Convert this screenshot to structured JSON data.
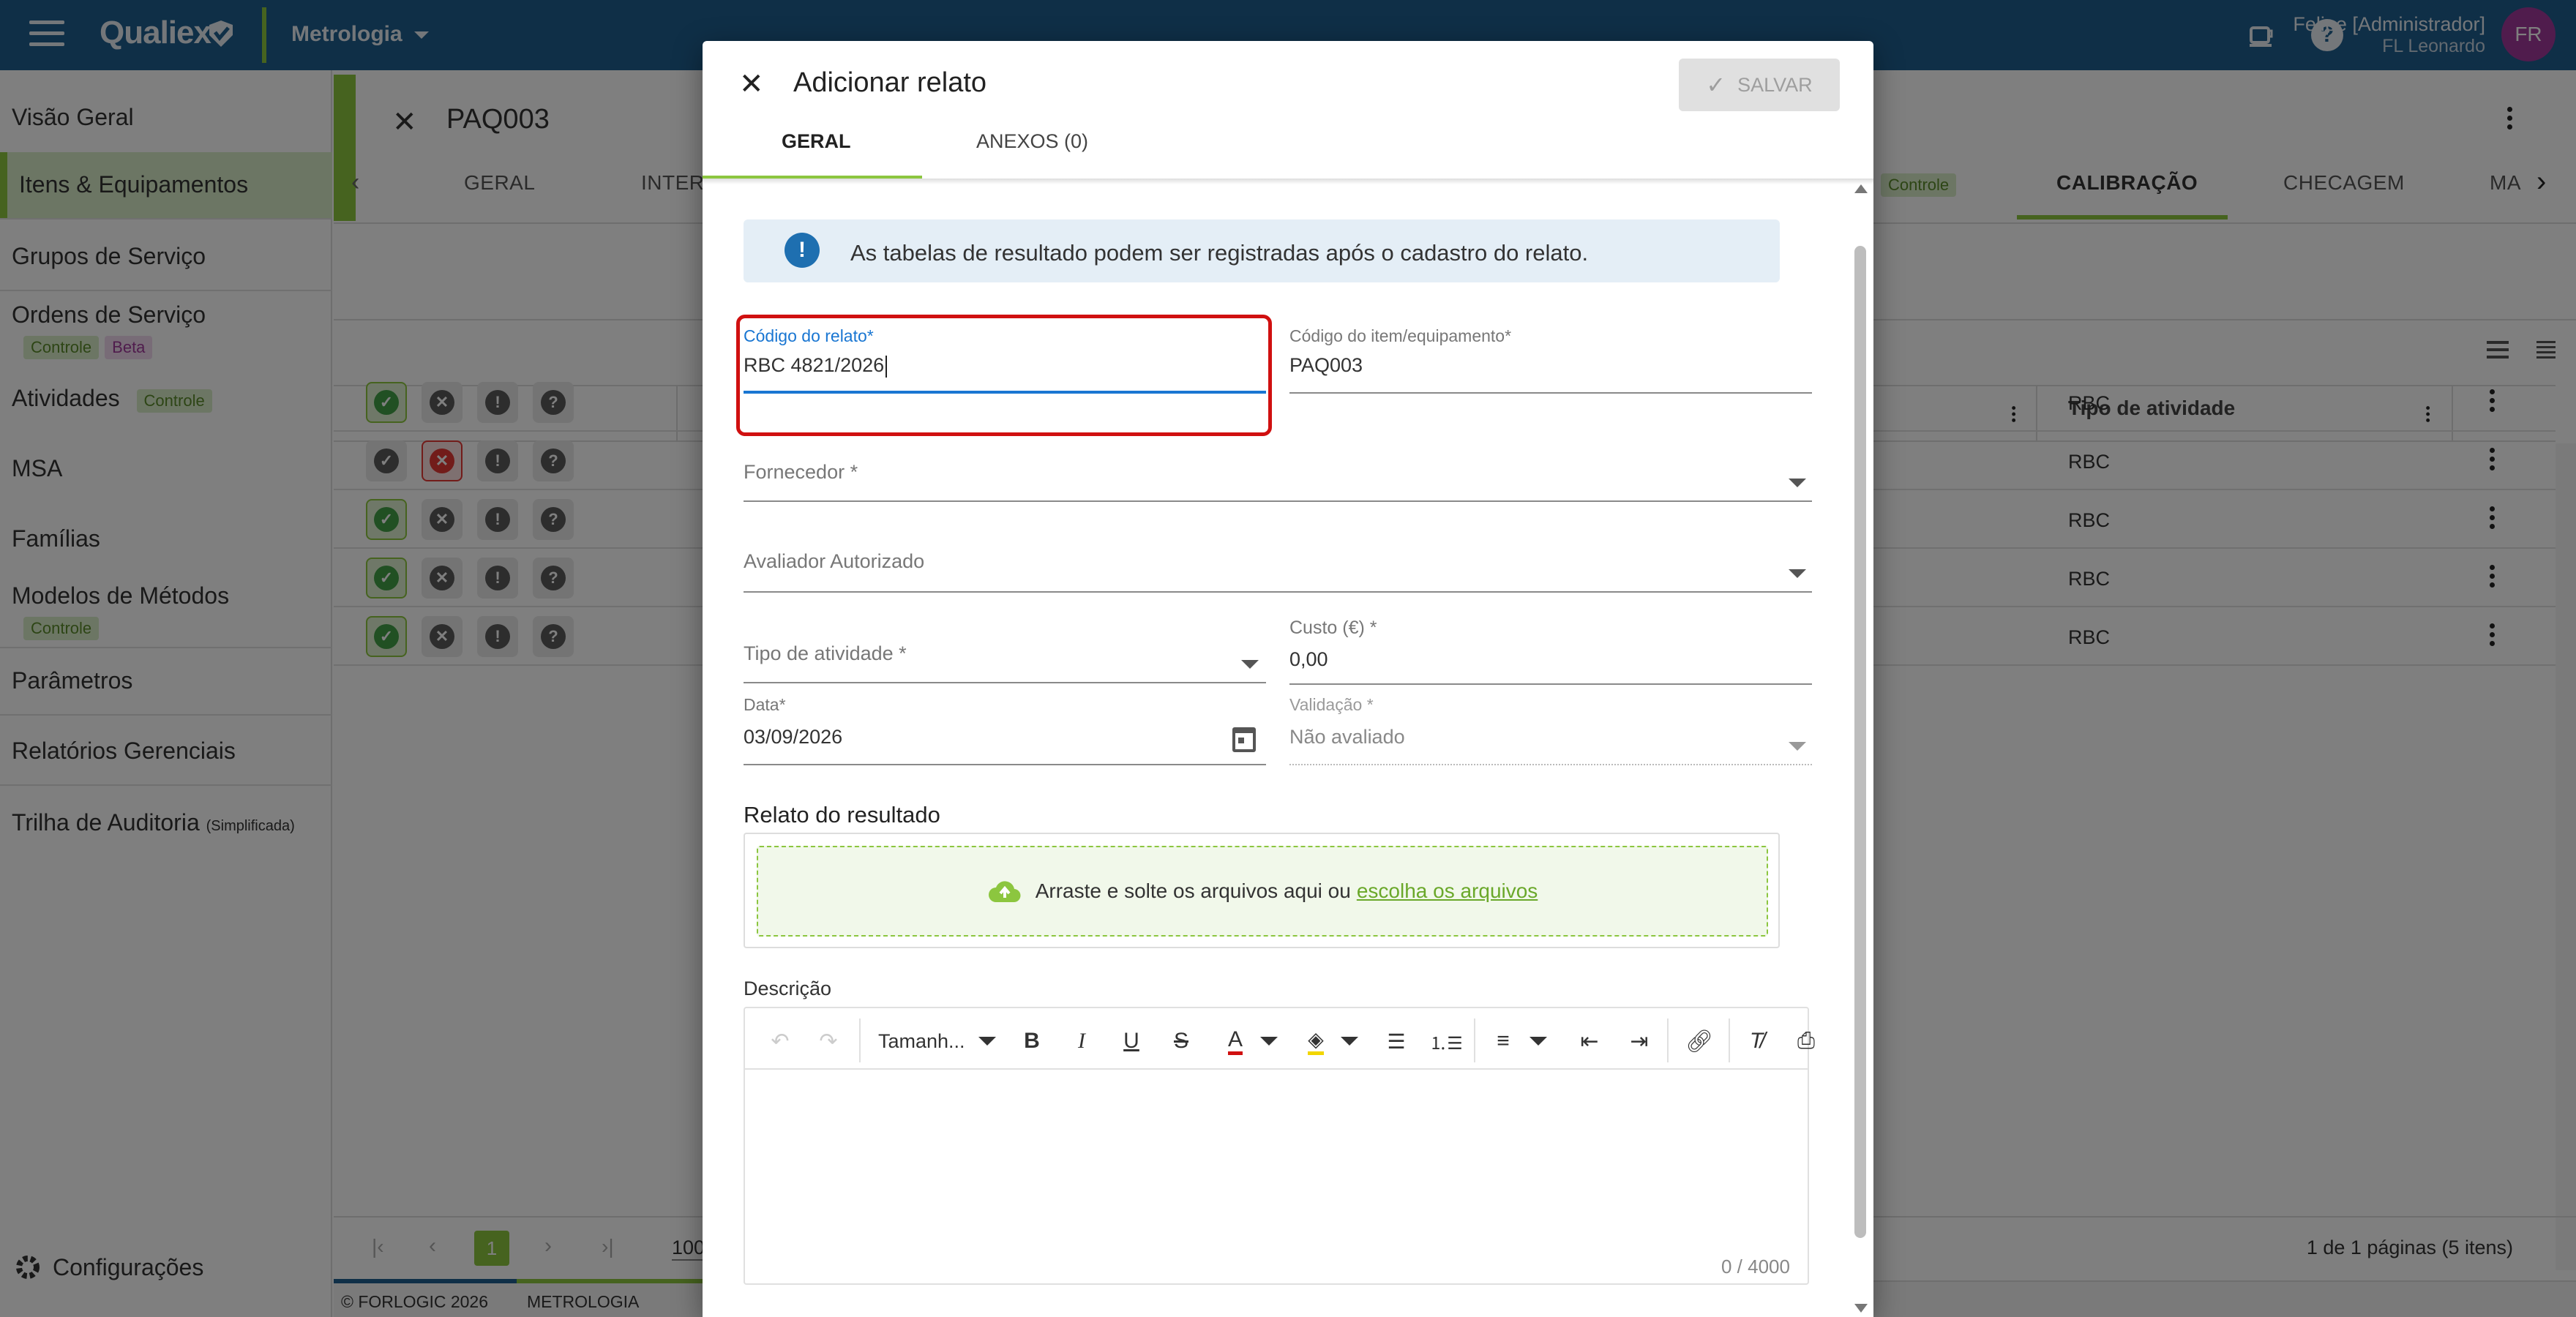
{
  "topbar": {
    "app_name": "Qualiex",
    "module": "Metrologia",
    "user_name": "Felipe [Administrador]",
    "user_company": "FL Leonardo",
    "avatar_initials": "FR"
  },
  "sidebar": {
    "items": [
      {
        "label": "Visão Geral"
      },
      {
        "label": "Itens & Equipamentos"
      },
      {
        "label": "Grupos de Serviço"
      },
      {
        "label": "Ordens de Serviço",
        "badges": [
          "Controle",
          "Beta"
        ]
      },
      {
        "label": "Atividades",
        "badges": [
          "Controle"
        ]
      },
      {
        "label": "MSA"
      },
      {
        "label": "Famílias"
      },
      {
        "label": "Modelos de Métodos",
        "badges": [
          "Controle"
        ]
      },
      {
        "label": "Parâmetros"
      },
      {
        "label": "Relatórios Gerenciais"
      },
      {
        "label": "Trilha de Auditoria",
        "suffix": "(Simplificada)"
      }
    ],
    "settings_label": "Configurações"
  },
  "main": {
    "item_code": "PAQ003",
    "tabs": {
      "geral": "GERAL",
      "interv": "INTERV",
      "controle_badge": "Controle",
      "calibracao": "CALIBRAÇÃO",
      "checagem": "CHECAGEM",
      "ma": "MA"
    },
    "table": {
      "column_activity_type": "Tipo de atividade",
      "rows": [
        {
          "activity_type": "RBC",
          "status": "ok"
        },
        {
          "activity_type": "RBC",
          "status": "fail"
        },
        {
          "activity_type": "RBC",
          "status": "ok"
        },
        {
          "activity_type": "RBC",
          "status": "ok"
        },
        {
          "activity_type": "RBC",
          "status": "ok"
        }
      ]
    },
    "pagination": {
      "current_page": "1",
      "page_size": "100",
      "summary": "1 de 1 páginas (5 itens)"
    }
  },
  "footer": {
    "copyright": "© FORLOGIC 2026",
    "module": "METROLOGIA"
  },
  "modal": {
    "title": "Adicionar relato",
    "save_label": "SALVAR",
    "tabs": {
      "geral": "GERAL",
      "anexos": "ANEXOS (0)"
    },
    "info_text": "As tabelas de resultado podem ser registradas após o cadastro do relato.",
    "fields": {
      "codigo_relato": {
        "label": "Código do relato*",
        "value": "RBC 4821/2026"
      },
      "codigo_item": {
        "label": "Código do item/equipamento*",
        "value": "PAQ003"
      },
      "fornecedor": {
        "label": "Fornecedor *"
      },
      "avaliador": {
        "label": "Avaliador Autorizado"
      },
      "tipo_atividade": {
        "label": "Tipo de atividade *"
      },
      "custo": {
        "label": "Custo (€) *",
        "value": "0,00"
      },
      "data": {
        "label": "Data*",
        "value": "03/09/2026"
      },
      "validacao": {
        "label": "Validação *",
        "value": "Não avaliado"
      }
    },
    "relato_section": "Relato do resultado",
    "dropzone_text": "Arraste e solte os arquivos aqui ou",
    "dropzone_link": "escolha os arquivos",
    "descricao_label": "Descrição",
    "editor": {
      "font_size_label": "Tamanh...",
      "char_count": "0 / 4000"
    }
  },
  "colors": {
    "topbar": "#1e5f8e",
    "accent_green": "#8cc63f",
    "focus_blue": "#1976d2",
    "highlight_red": "#d01010"
  }
}
